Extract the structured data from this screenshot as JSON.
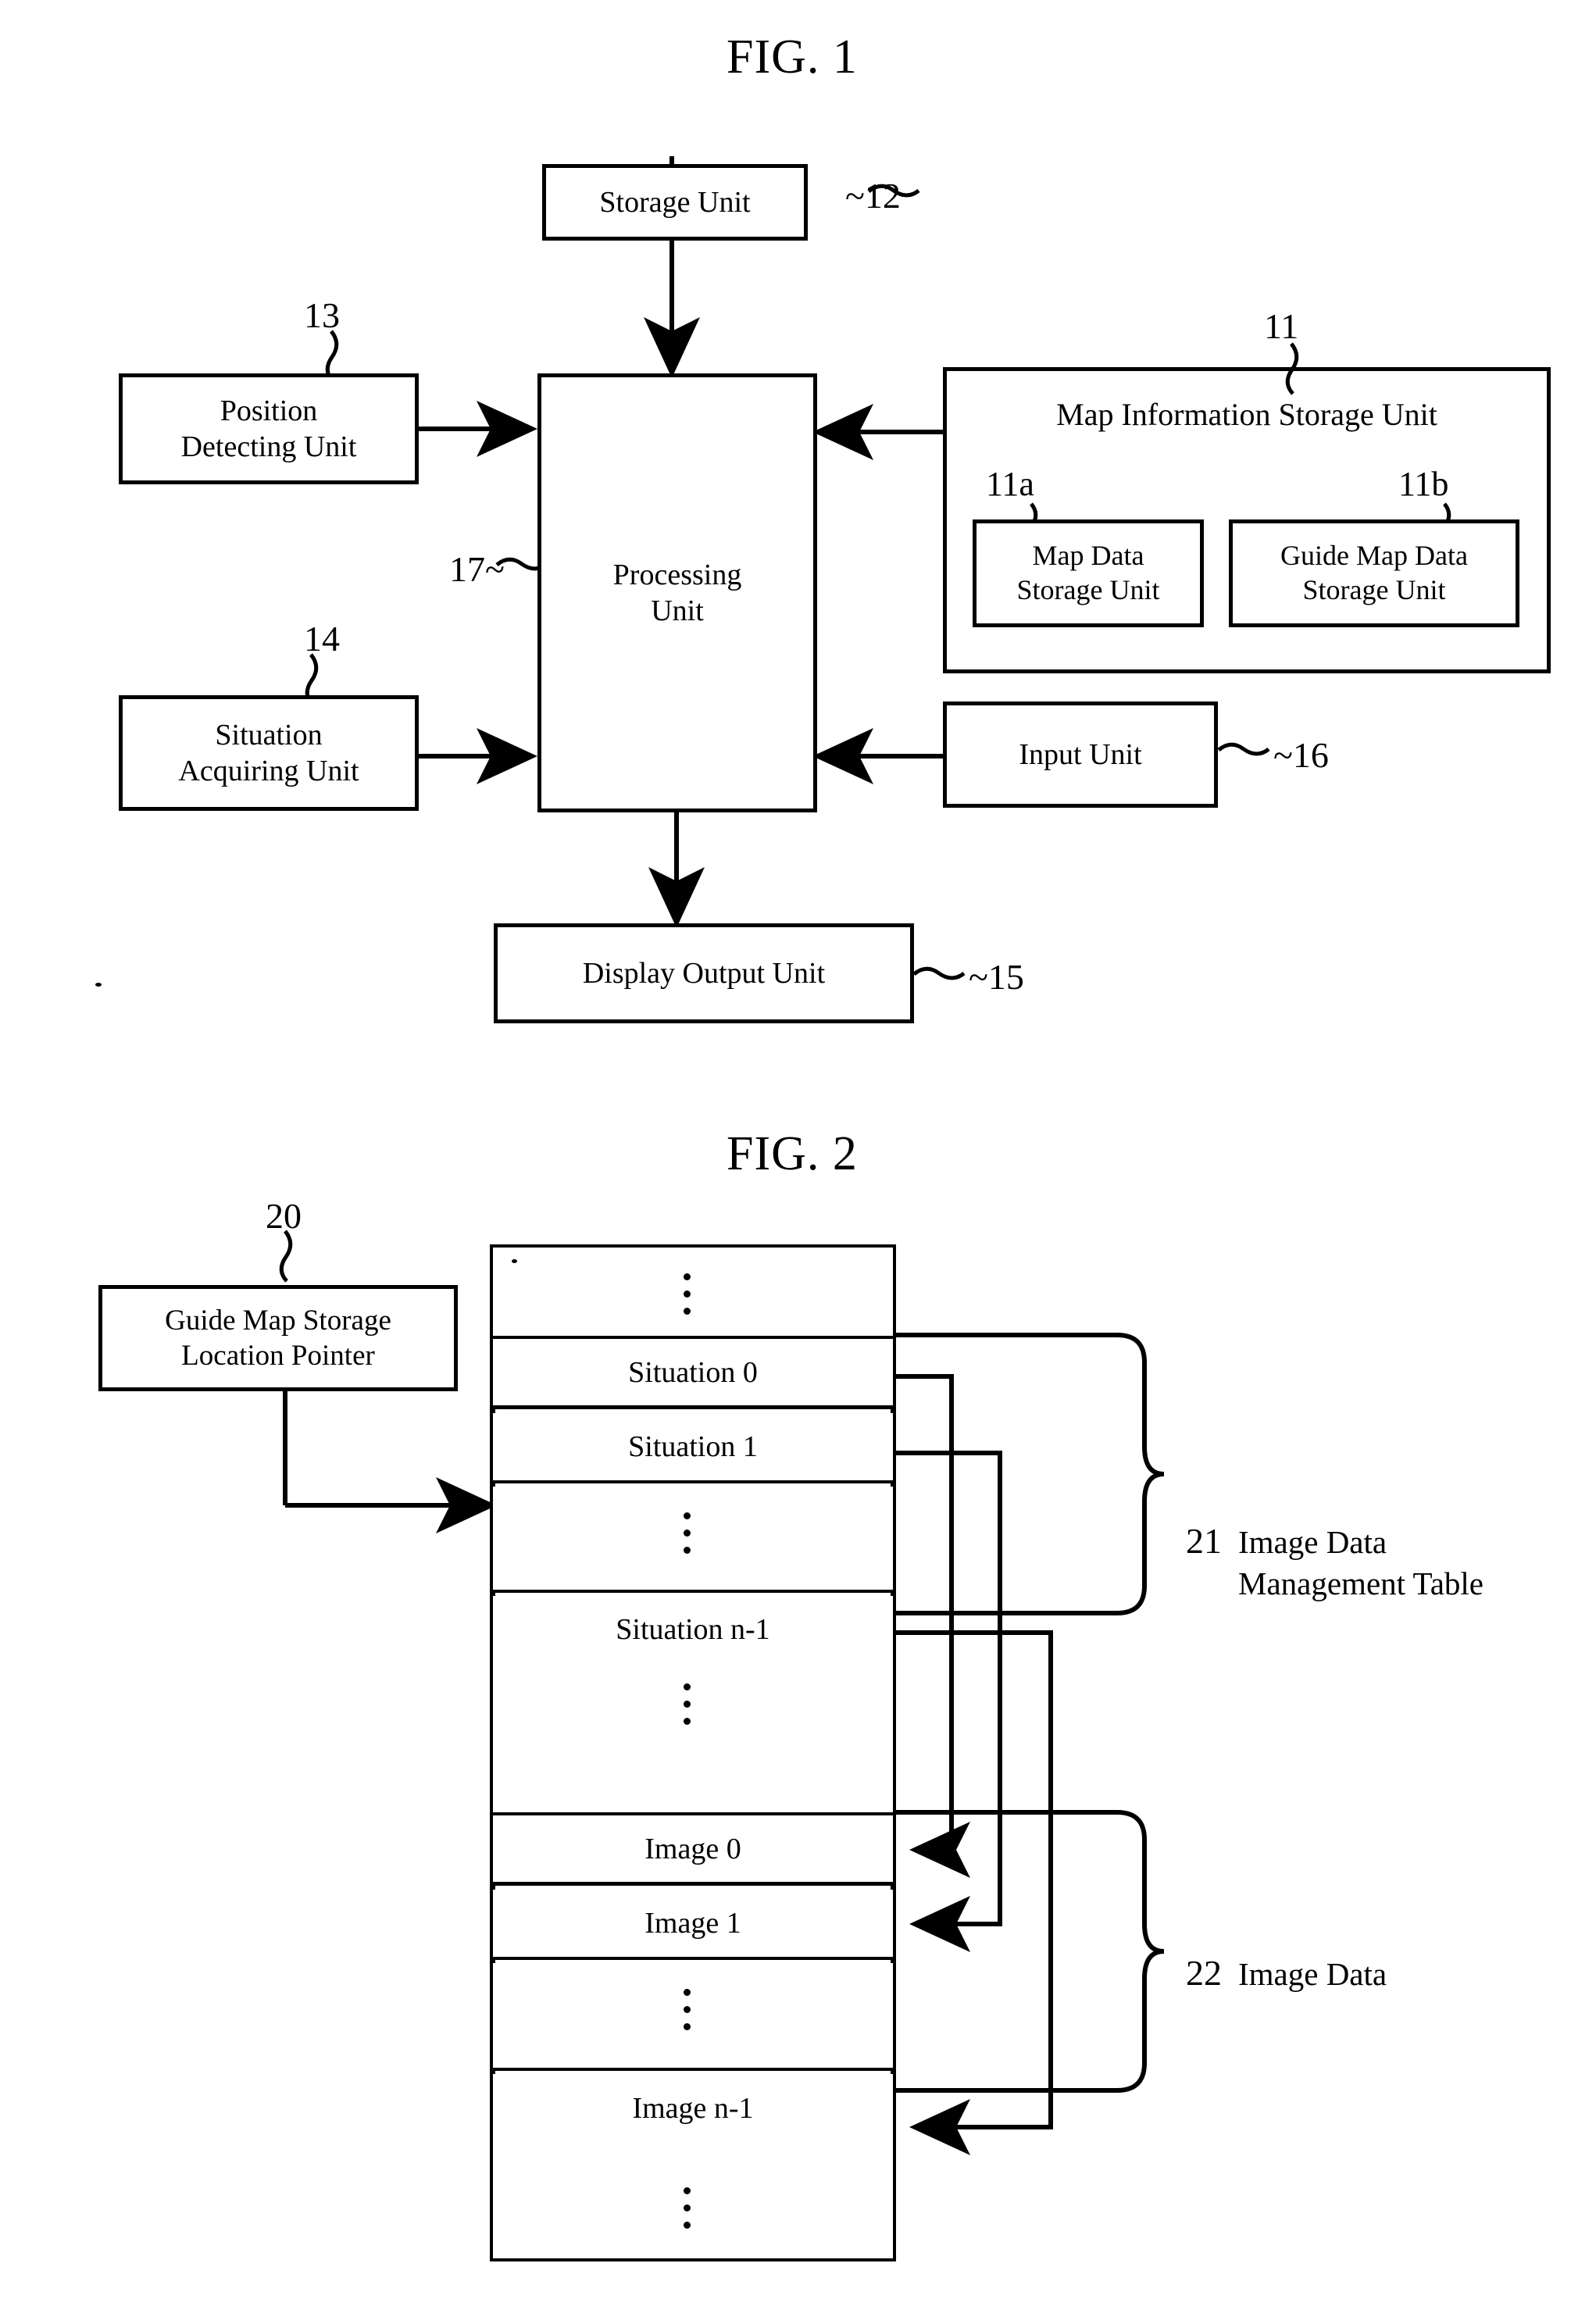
{
  "figures": [
    {
      "title": "FIG. 1",
      "blocks": {
        "storage_unit": "Storage Unit",
        "position_detecting_unit": "Position\nDetecting Unit",
        "situation_acquiring_unit": "Situation\nAcquiring Unit",
        "processing_unit": "Processing\nUnit",
        "map_information_storage_unit": "Map Information Storage Unit",
        "map_data_storage_unit": "Map Data\nStorage Unit",
        "guide_map_data_storage_unit": "Guide Map Data\nStorage Unit",
        "input_unit": "Input Unit",
        "display_output_unit": "Display Output Unit"
      },
      "refs": {
        "storage_unit": "12",
        "position_detecting_unit": "13",
        "situation_acquiring_unit": "14",
        "processing_unit": "17",
        "map_information_storage_unit": "11",
        "map_data_storage_unit": "11a",
        "guide_map_data_storage_unit": "11b",
        "input_unit": "16",
        "display_output_unit": "15"
      },
      "ref_marks": {
        "storage_unit": "~12",
        "input_unit": "~16",
        "display_output_unit": "~15",
        "processing_unit": "17~"
      }
    },
    {
      "title": "FIG. 2",
      "blocks": {
        "guide_map_storage_location_pointer": "Guide Map Storage\nLocation Pointer"
      },
      "refs": {
        "guide_map_storage_location_pointer": "20",
        "image_data_management_table": "21",
        "image_data": "22"
      },
      "captions": {
        "image_data_management_table": "Image Data\nManagement Table",
        "image_data": "Image Data"
      },
      "memory_rows": {
        "situation_rows": [
          "Situation 0",
          "Situation 1",
          "Situation n-1"
        ],
        "image_rows": [
          "Image 0",
          "Image 1",
          "Image n-1"
        ],
        "ellipsis": "vertical-ellipsis"
      }
    }
  ],
  "colors": {
    "ink": "#000000",
    "paper": "#ffffff"
  }
}
